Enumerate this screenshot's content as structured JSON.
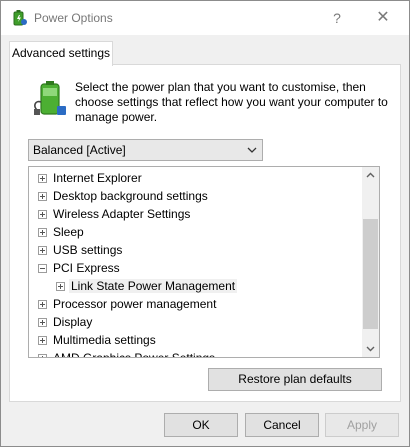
{
  "window": {
    "title": "Power Options",
    "help_glyph": "?",
    "close_glyph": "✕",
    "icon": "power-options-icon"
  },
  "tab": {
    "label": "Advanced settings"
  },
  "description": "Select the power plan that you want to customise, then choose settings that reflect how you want your computer to manage power.",
  "plan_select": {
    "value": "Balanced [Active]"
  },
  "tree": {
    "items": [
      {
        "label": "Internet Explorer",
        "state": "collapsed",
        "level": 0
      },
      {
        "label": "Desktop background settings",
        "state": "collapsed",
        "level": 0
      },
      {
        "label": "Wireless Adapter Settings",
        "state": "collapsed",
        "level": 0
      },
      {
        "label": "Sleep",
        "state": "collapsed",
        "level": 0
      },
      {
        "label": "USB settings",
        "state": "collapsed",
        "level": 0
      },
      {
        "label": "PCI Express",
        "state": "expanded",
        "level": 0
      },
      {
        "label": "Link State Power Management",
        "state": "collapsed",
        "level": 1
      },
      {
        "label": "Processor power management",
        "state": "collapsed",
        "level": 0
      },
      {
        "label": "Display",
        "state": "collapsed",
        "level": 0
      },
      {
        "label": "Multimedia settings",
        "state": "collapsed",
        "level": 0
      },
      {
        "label": "AMD Graphics Power Settings",
        "state": "collapsed",
        "level": 0
      }
    ]
  },
  "restore_button": {
    "label": "Restore plan defaults"
  },
  "buttons": {
    "ok": "OK",
    "cancel": "Cancel",
    "apply": "Apply"
  },
  "colors": {
    "battery_green": "#4caf32",
    "selection_bg": "#f0f0f0"
  }
}
